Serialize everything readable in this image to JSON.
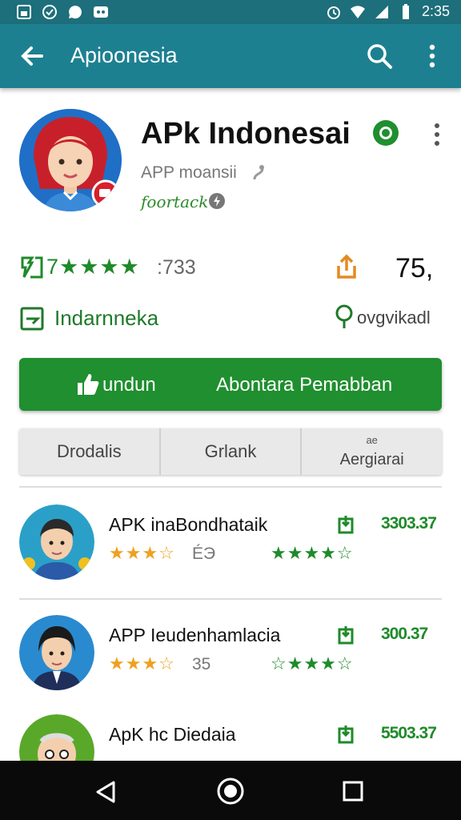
{
  "status_bar": {
    "time": "2:35"
  },
  "app_bar": {
    "title": "Apioonesia"
  },
  "hero": {
    "app_title": "APk Indonesai",
    "developer": "APP moansii",
    "category": "foortack"
  },
  "stats": {
    "rating_text": "7★★★★",
    "rating_count": ":733",
    "size": "75,"
  },
  "info": {
    "left": "Indarnneka",
    "right": "ovgvikadl"
  },
  "install_button": {
    "label_left": "undun",
    "label_right": "Abontara Pemabban"
  },
  "tabs": [
    {
      "label": "Drodalis"
    },
    {
      "label": "Grlank"
    },
    {
      "small": "ae",
      "label": "Aergiarai"
    }
  ],
  "list": [
    {
      "title": "APK inaBondhataik",
      "stars": "★★★☆",
      "sub": "ÉЭ",
      "stars2": "★★★★☆",
      "value": "3303.37"
    },
    {
      "title": "APP Ieudenhamlacia",
      "stars": "★★★☆",
      "sub": "35",
      "stars2": "☆★★★☆",
      "value": "300.37"
    },
    {
      "title": "ApK hc Diedaia",
      "stars": "",
      "sub": "",
      "stars2": "",
      "value": "5503.37"
    }
  ],
  "colors": {
    "appbar": "#1d8090",
    "status_bar": "#1d6f7b",
    "green": "#1f8f2f",
    "star_orange": "#f0a020"
  }
}
